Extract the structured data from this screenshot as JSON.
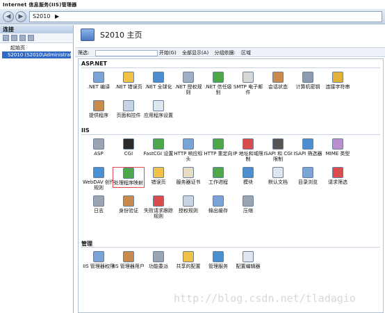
{
  "window": {
    "title": "Internet 信息服务(IIS)管理器"
  },
  "address": {
    "segments": [
      "S2010",
      "▶"
    ]
  },
  "left_panel": {
    "header": "连接",
    "tree": [
      "起始页",
      "S2010 (S2010\\Administrator)"
    ]
  },
  "main": {
    "title": "S2010 主页",
    "filter": {
      "label": "筛选:",
      "start": "开始(G)",
      "show_all": "全部显示(A)",
      "group": "分组依据:",
      "group_value": "区域"
    },
    "sections": [
      {
        "title": "ASP.NET",
        "items": [
          {
            "label": ".NET 编译",
            "color": "#7aa3d8"
          },
          {
            "label": ".NET 错误页",
            "color": "#f0c348"
          },
          {
            "label": ".NET 全球化",
            "color": "#4b8fd0"
          },
          {
            "label": ".NET 授权规则",
            "color": "#9fb0c6"
          },
          {
            "label": ".NET 信任级别",
            "color": "#4da84a"
          },
          {
            "label": "SMTP 电子邮件",
            "color": "#d8d8d8"
          },
          {
            "label": "会话状态",
            "color": "#c98a4b"
          },
          {
            "label": "计算机密钥",
            "color": "#8d9bb0"
          },
          {
            "label": "连接字符串",
            "color": "#e2b23a"
          },
          {
            "label": "提供程序",
            "color": "#c98a4b"
          },
          {
            "label": "页面和控件",
            "color": "#c9d4e2"
          },
          {
            "label": "应用程序设置",
            "color": "#dfe6ef"
          }
        ]
      },
      {
        "title": "IIS",
        "items": [
          {
            "label": "ASP",
            "color": "#9aa5b4"
          },
          {
            "label": "CGI",
            "color": "#2b2b2b"
          },
          {
            "label": "FastCGI 设置",
            "color": "#4da84a"
          },
          {
            "label": "HTTP 响应标头",
            "color": "#7aa3d8"
          },
          {
            "label": "HTTP 重定向",
            "color": "#4da84a"
          },
          {
            "label": "IP 地址和域限制",
            "color": "#d94c4c"
          },
          {
            "label": "ISAPI 和 CGI 限制",
            "color": "#555555"
          },
          {
            "label": "ISAPI 筛选器",
            "color": "#4b8fd0"
          },
          {
            "label": "MIME 类型",
            "color": "#b98fcf"
          },
          {
            "label": "WebDAV 创作规则",
            "color": "#4b8fd0"
          },
          {
            "label": "处理程序映射",
            "color": "#4da84a"
          },
          {
            "label": "错误页",
            "color": "#f0c348"
          },
          {
            "label": "服务器证书",
            "color": "#e6dcc2"
          },
          {
            "label": "工作进程",
            "color": "#4da84a"
          },
          {
            "label": "模块",
            "color": "#4b8fd0"
          },
          {
            "label": "默认文档",
            "color": "#dfe6ef"
          },
          {
            "label": "目录浏览",
            "color": "#7aa3d8"
          },
          {
            "label": "请求筛选",
            "color": "#d94c4c"
          },
          {
            "label": "日志",
            "color": "#9aa5b4"
          },
          {
            "label": "身份验证",
            "color": "#c98a4b"
          },
          {
            "label": "失败请求跟踪规则",
            "color": "#d94c4c"
          },
          {
            "label": "授权规则",
            "color": "#c9d4e2"
          },
          {
            "label": "输出缓存",
            "color": "#7aa3d8"
          },
          {
            "label": "压缩",
            "color": "#9aa5b4"
          }
        ]
      },
      {
        "title": "管理",
        "items": [
          {
            "label": "IIS 管理器权限",
            "color": "#7aa3d8"
          },
          {
            "label": "IIS 管理器用户",
            "color": "#c98a4b"
          },
          {
            "label": "功能委派",
            "color": "#9aa5b4"
          },
          {
            "label": "共享的配置",
            "color": "#f0c348"
          },
          {
            "label": "管理服务",
            "color": "#4b8fd0"
          },
          {
            "label": "配置编辑器",
            "color": "#dfe6ef"
          }
        ]
      }
    ]
  },
  "watermark": "http://blog.csdn.net/tladagio"
}
